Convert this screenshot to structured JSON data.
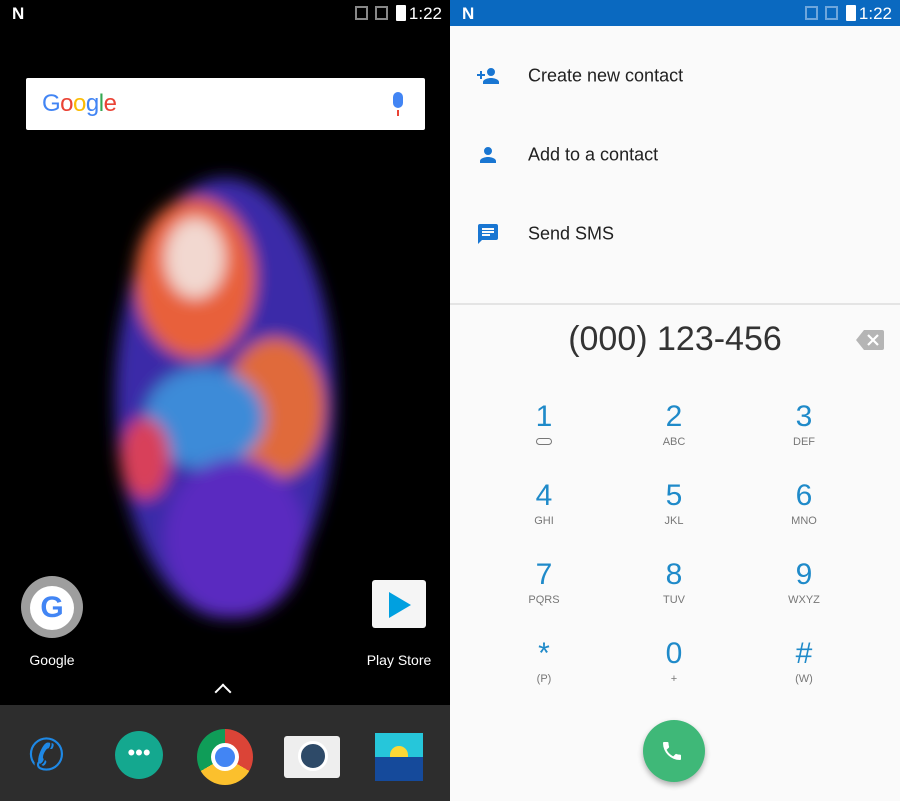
{
  "status_bar": {
    "time": "1:22",
    "logo": "N"
  },
  "home": {
    "search": {
      "logo": "Google",
      "mic_icon": "mic-icon"
    },
    "apps": [
      {
        "label": "Google",
        "icon": "google-app-icon"
      },
      {
        "label": "Play Store",
        "icon": "play-store-icon"
      }
    ],
    "dock": [
      {
        "icon": "phone-icon"
      },
      {
        "icon": "hangouts-icon"
      },
      {
        "icon": "chrome-icon"
      },
      {
        "icon": "camera-icon"
      },
      {
        "icon": "gallery-icon"
      }
    ]
  },
  "dialer": {
    "menu": [
      {
        "label": "Create new contact",
        "icon": "person-add-icon"
      },
      {
        "label": "Add to a contact",
        "icon": "person-icon"
      },
      {
        "label": "Send SMS",
        "icon": "message-icon"
      }
    ],
    "number": "(000) 123-456",
    "keys": [
      {
        "digit": "1",
        "letters": ""
      },
      {
        "digit": "2",
        "letters": "ABC"
      },
      {
        "digit": "3",
        "letters": "DEF"
      },
      {
        "digit": "4",
        "letters": "GHI"
      },
      {
        "digit": "5",
        "letters": "JKL"
      },
      {
        "digit": "6",
        "letters": "MNO"
      },
      {
        "digit": "7",
        "letters": "PQRS"
      },
      {
        "digit": "8",
        "letters": "TUV"
      },
      {
        "digit": "9",
        "letters": "WXYZ"
      },
      {
        "digit": "*",
        "letters": "(P)"
      },
      {
        "digit": "0",
        "letters": "+"
      },
      {
        "digit": "#",
        "letters": "(W)"
      }
    ],
    "accent": "#1f8ac9",
    "call_color": "#3fb878",
    "status_color": "#0a69c0"
  }
}
